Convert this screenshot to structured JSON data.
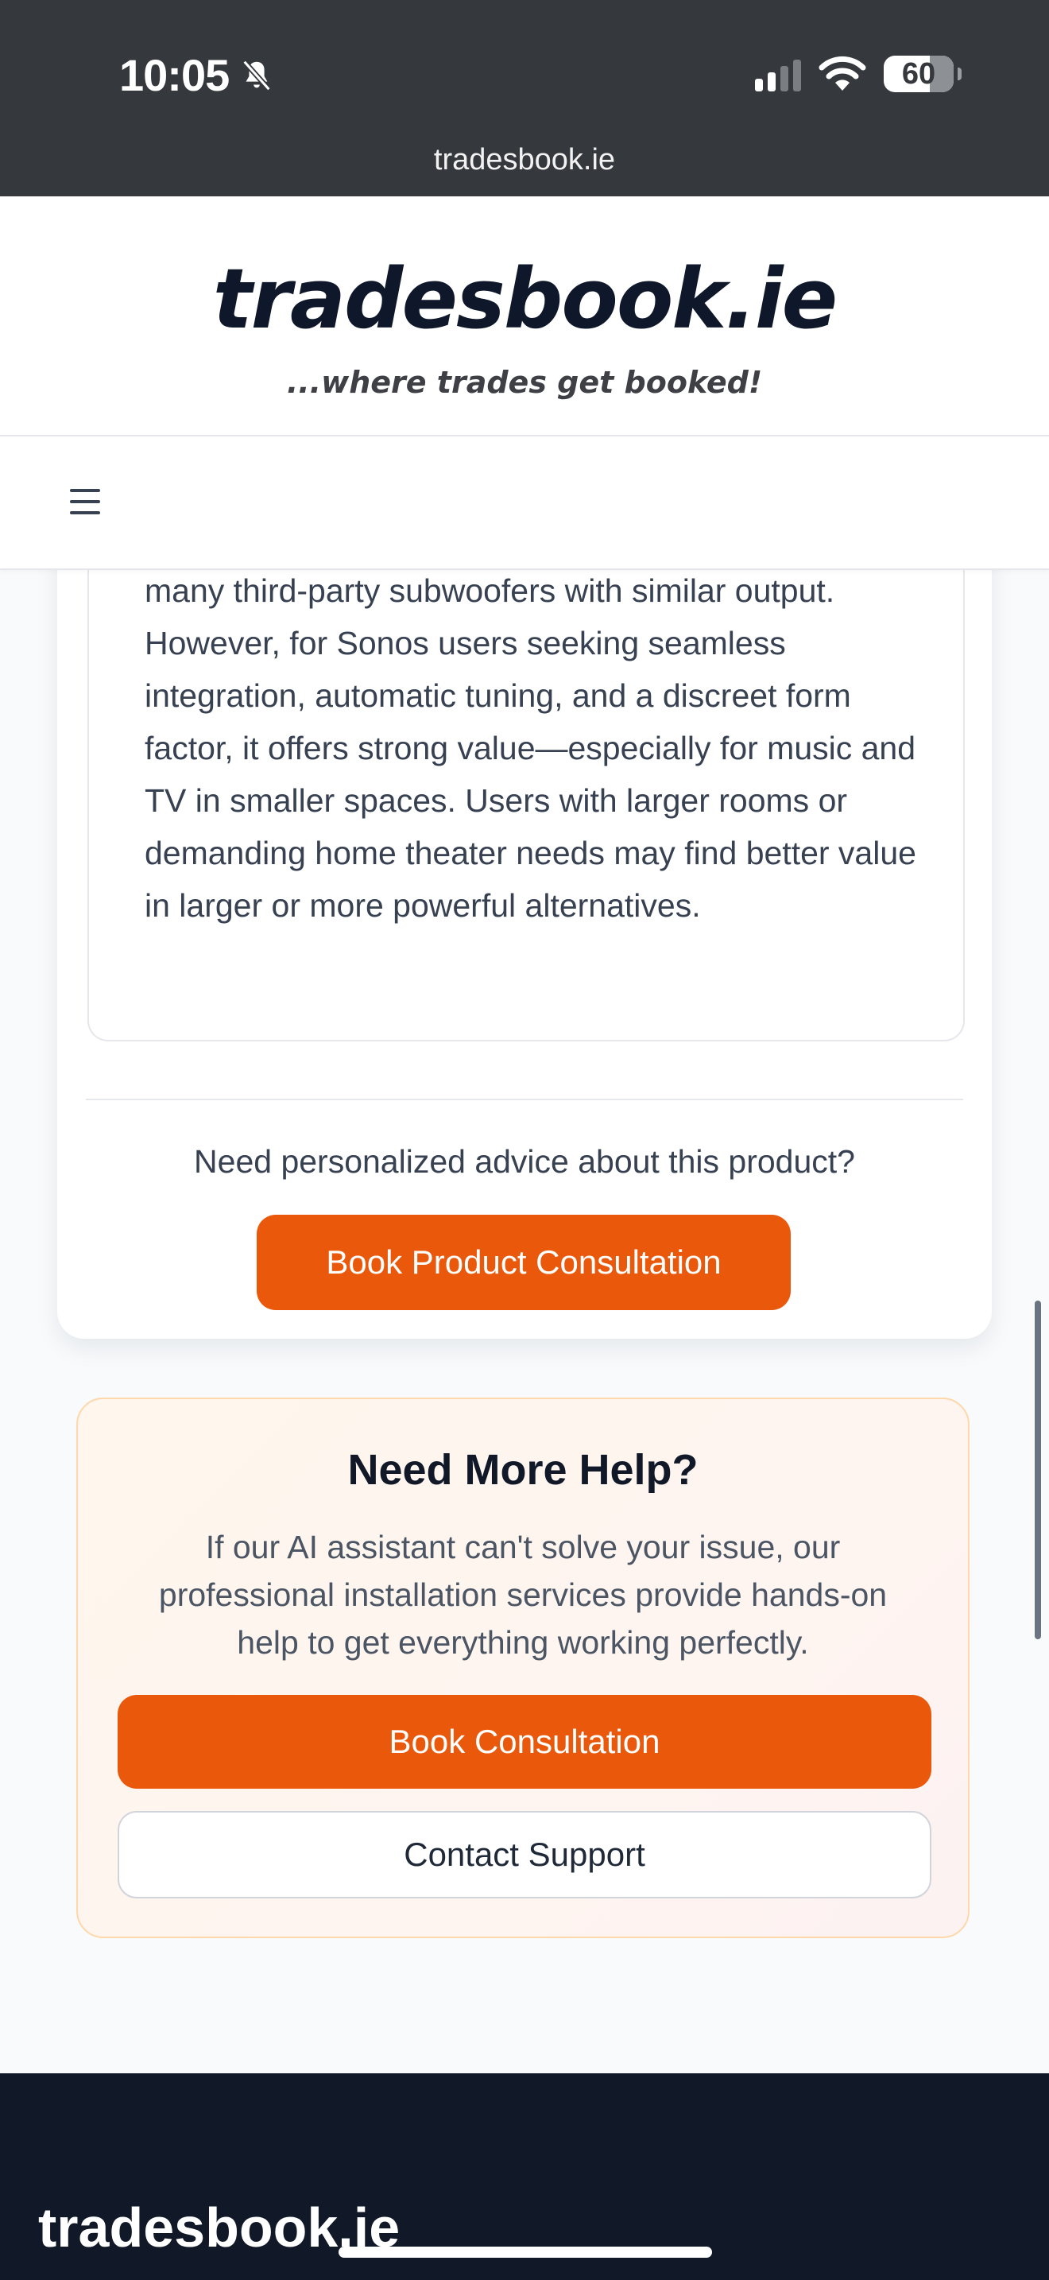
{
  "status_bar": {
    "time": "10:05",
    "battery": "60"
  },
  "browser": {
    "url": "tradesbook.ie"
  },
  "header": {
    "logo": "tradesbook.ie",
    "tagline": "...where trades get booked!"
  },
  "product": {
    "value_text": "many third-party subwoofers with similar output. However, for Sonos users seeking seamless integration, automatic tuning, and a discreet form factor, it offers strong value—especially for music and TV in smaller spaces. Users with larger rooms or demanding home theater needs may find better value in larger or more powerful alternatives.",
    "advice_prompt": "Need personalized advice about this product?",
    "consult_button": "Book Product Consultation"
  },
  "help": {
    "title": "Need More Help?",
    "description": "If our AI assistant can't solve your issue, our professional installation services provide hands-on help to get everything working perfectly.",
    "consult_button": "Book Consultation",
    "contact_button": "Contact Support"
  },
  "footer": {
    "logo": "tradesbook.ie"
  },
  "colors": {
    "accent": "#ea580c",
    "footer_bg": "#111827",
    "status_bg": "#35383d"
  },
  "icons": {
    "notifications_muted": "bell-off-icon",
    "signal": "cellular-signal-icon",
    "wifi": "wifi-icon",
    "battery": "battery-icon",
    "menu": "hamburger-menu-icon"
  }
}
